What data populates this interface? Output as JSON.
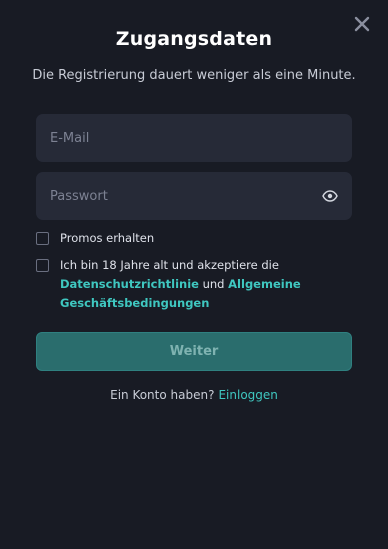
{
  "dialog": {
    "title": "Zugangsdaten",
    "subtitle": "Die Registrierung dauert weniger als eine Minute."
  },
  "icons": {
    "close": "close-icon",
    "password_visibility": "eye-icon"
  },
  "form": {
    "email": {
      "placeholder": "E-Mail",
      "value": ""
    },
    "password": {
      "placeholder": "Passwort",
      "value": ""
    },
    "promos": {
      "label": "Promos erhalten",
      "checked": false
    },
    "terms": {
      "text_before": "Ich bin 18 Jahre alt und akzeptiere die",
      "privacy_link": "Datenschutzrichtlinie",
      "connector": "und",
      "terms_link": "Allgemeine Geschäftsbedingungen",
      "checked": false
    },
    "submit_label": "Weiter"
  },
  "footer": {
    "prompt": "Ein Konto haben?",
    "login_link": "Einloggen"
  },
  "colors": {
    "background": "#181b24",
    "field_background": "#262a37",
    "accent": "#3fc7c0",
    "button_background": "#2a6d6d"
  }
}
